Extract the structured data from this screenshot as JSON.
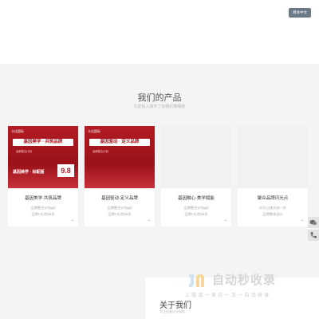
{
  "header": {
    "lang_label": "简体中文"
  },
  "products": {
    "title": "我们的产品",
    "subtitle": "凡爱投入做不了好我们做哪些",
    "cards": [
      {
        "name": "基因美学·共筑品牌",
        "lines": [
          "品牌整合计划ppt",
          "品牌VI识别体系"
        ],
        "banner": {
          "logo": "卡达国际",
          "headline": "基因美学 · 共筑品牌",
          "subline": "品牌整合计划",
          "footer": "基因美学 · 标配版",
          "price": "9.8"
        }
      },
      {
        "name": "基因驱动·定义品牌",
        "lines": [
          "品牌整合计划ppt",
          "品牌VI识别体系"
        ],
        "banner": {
          "logo": "卡达国际",
          "headline": "基因驱动 · 定义品牌",
          "subline": "品牌整合计划"
        }
      },
      {
        "name": "基因触心·美学赋能",
        "lines": [
          "品牌整合计划ppt",
          "品牌VI识别体系"
        ]
      },
      {
        "name": "聚众品牌闪光点",
        "lines": [
          "30天日夜共创一份",
          "品牌整体设计"
        ]
      }
    ],
    "card_arrow": "→"
  },
  "about": {
    "title": "关于我们",
    "subtitle": "专注创意设计服务"
  },
  "watermark": {
    "brand": "自动秒收录",
    "line": "上 链 接 一 来 访 一 次 一 自 动 收 录"
  },
  "side_tools": [
    "微信",
    "电话"
  ],
  "colors": {
    "brand_red": "#b31c23",
    "lang_bg": "#6b7888"
  }
}
